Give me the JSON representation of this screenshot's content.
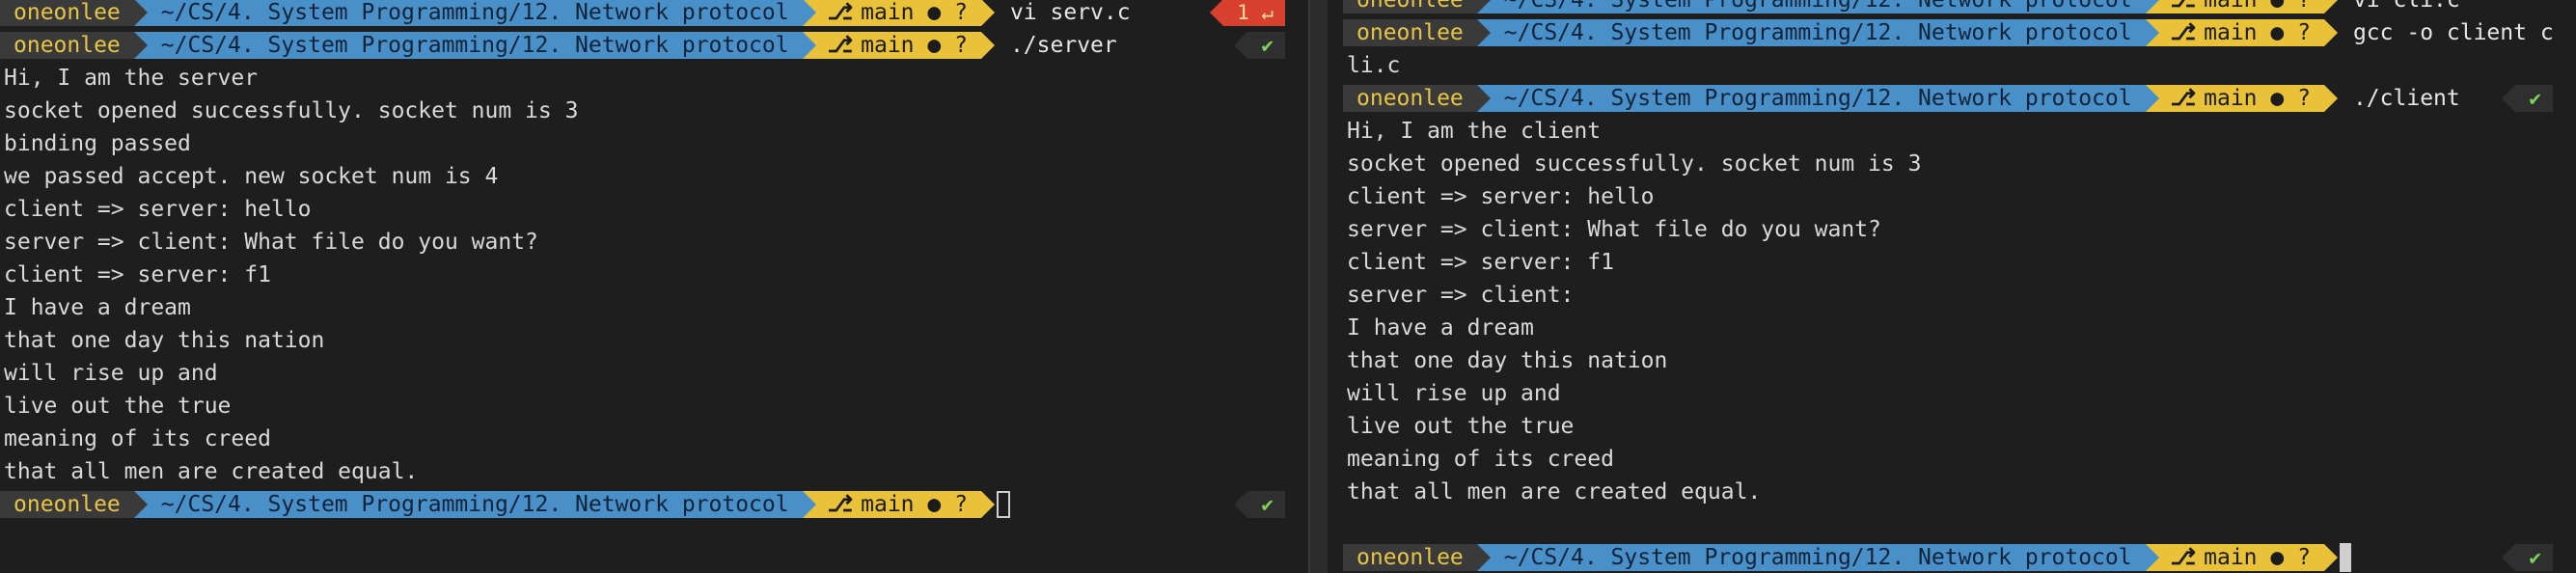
{
  "prompt": {
    "user": "oneonlee",
    "path": "~/CS/4. System Programming/12. Network protocol",
    "branch_icon": "branch-icon",
    "branch": "main",
    "dirty": "●",
    "untracked": "?"
  },
  "left": {
    "commands": {
      "first": "vi serv.c",
      "second": "./server"
    },
    "status": {
      "error": "1 ↵",
      "ok": "✔"
    },
    "output": [
      "Hi, I am the server",
      "socket opened successfully. socket num is 3",
      "binding passed",
      "we passed accept. new socket num is 4",
      "client => server: hello",
      "server => client: What file do you want?",
      "client => server: f1",
      "I have a dream",
      "that one day this nation",
      "will rise up and",
      "live out the true",
      "meaning of its creed",
      "that all men are created equal."
    ]
  },
  "right": {
    "commands": {
      "first": "vi cli.c",
      "second": "gcc -o client c",
      "second_wrap": "li.c",
      "third": "./client"
    },
    "status": {
      "ok": "✔"
    },
    "output": [
      "Hi, I am the client",
      "socket opened successfully. socket num is 3",
      "client => server: hello",
      "server => client: What file do you want?",
      "client => server: f1",
      "server => client:",
      "I have a dream",
      "that one day this nation",
      "will rise up and",
      "live out the true",
      "meaning of its creed",
      "that all men are created equal."
    ]
  },
  "colors": {
    "background": "#1e1e1e",
    "user_fg": "#e8c547",
    "path_bg": "#4a90c8",
    "git_bg": "#e9c23a",
    "error_bg": "#d7402f",
    "ok_fg": "#7fd35c"
  }
}
